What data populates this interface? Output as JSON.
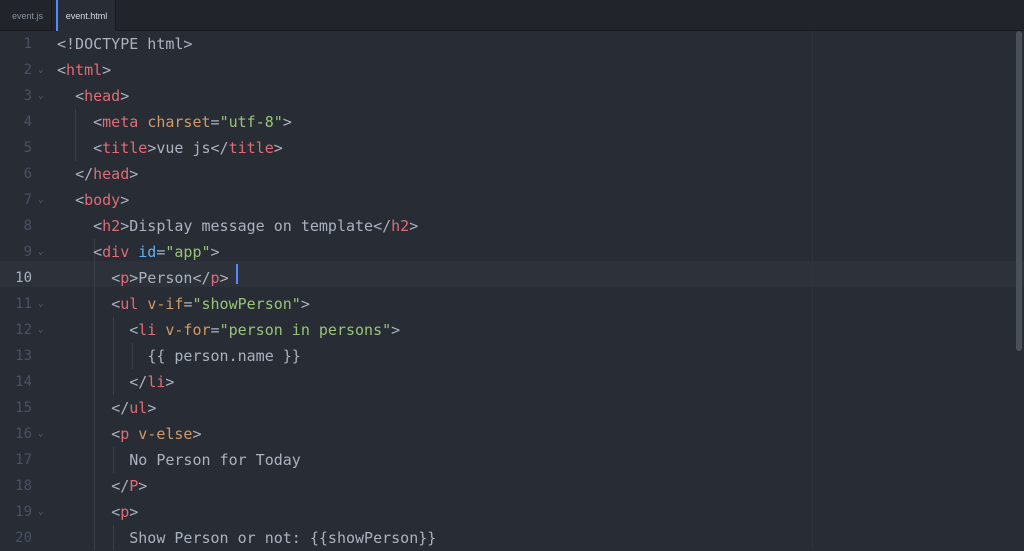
{
  "tabs": [
    {
      "label": "event.js",
      "active": false
    },
    {
      "label": "event.html",
      "active": true
    }
  ],
  "editor": {
    "current_line": 10,
    "lines": [
      {
        "n": "1",
        "fold": "",
        "ind": "",
        "seg": [
          [
            "p",
            "<!DOCTYPE html>"
          ]
        ]
      },
      {
        "n": "2",
        "fold": "⌄",
        "ind": "",
        "seg": [
          [
            "p",
            "<"
          ],
          [
            "t",
            "html"
          ],
          [
            "p",
            ">"
          ]
        ]
      },
      {
        "n": "3",
        "fold": "⌄",
        "ind": "  ",
        "seg": [
          [
            "p",
            "<"
          ],
          [
            "t",
            "head"
          ],
          [
            "p",
            ">"
          ]
        ]
      },
      {
        "n": "4",
        "fold": "",
        "ind": "    ",
        "seg": [
          [
            "p",
            "<"
          ],
          [
            "t",
            "meta"
          ],
          [
            "p",
            " "
          ],
          [
            "a",
            "charset"
          ],
          [
            "p",
            "="
          ],
          [
            "s",
            "\"utf-8\""
          ],
          [
            "p",
            ">"
          ]
        ]
      },
      {
        "n": "5",
        "fold": "",
        "ind": "    ",
        "seg": [
          [
            "p",
            "<"
          ],
          [
            "t",
            "title"
          ],
          [
            "p",
            ">vue js</"
          ],
          [
            "t",
            "title"
          ],
          [
            "p",
            ">"
          ]
        ]
      },
      {
        "n": "6",
        "fold": "",
        "ind": "  ",
        "seg": [
          [
            "p",
            "</"
          ],
          [
            "t",
            "head"
          ],
          [
            "p",
            ">"
          ]
        ]
      },
      {
        "n": "7",
        "fold": "⌄",
        "ind": "  ",
        "seg": [
          [
            "p",
            "<"
          ],
          [
            "t",
            "body"
          ],
          [
            "p",
            ">"
          ]
        ]
      },
      {
        "n": "8",
        "fold": "",
        "ind": "    ",
        "seg": [
          [
            "p",
            "<"
          ],
          [
            "t",
            "h2"
          ],
          [
            "p",
            ">Display message on template</"
          ],
          [
            "t",
            "h2"
          ],
          [
            "p",
            ">"
          ]
        ]
      },
      {
        "n": "9",
        "fold": "⌄",
        "ind": "    ",
        "seg": [
          [
            "p",
            "<"
          ],
          [
            "t",
            "div"
          ],
          [
            "p",
            " "
          ],
          [
            "b",
            "id"
          ],
          [
            "p",
            "="
          ],
          [
            "s",
            "\"app\""
          ],
          [
            "p",
            ">"
          ]
        ]
      },
      {
        "n": "10",
        "fold": "",
        "ind": "      ",
        "seg": [
          [
            "p",
            "<"
          ],
          [
            "t",
            "p"
          ],
          [
            "p",
            ">Person</"
          ],
          [
            "t",
            "p"
          ],
          [
            "p",
            ">"
          ]
        ]
      },
      {
        "n": "11",
        "fold": "⌄",
        "ind": "      ",
        "seg": [
          [
            "p",
            "<"
          ],
          [
            "t",
            "ul"
          ],
          [
            "p",
            " "
          ],
          [
            "a",
            "v-if"
          ],
          [
            "p",
            "="
          ],
          [
            "s",
            "\"showPerson\""
          ],
          [
            "p",
            ">"
          ]
        ]
      },
      {
        "n": "12",
        "fold": "⌄",
        "ind": "        ",
        "seg": [
          [
            "p",
            "<"
          ],
          [
            "t",
            "li"
          ],
          [
            "p",
            " "
          ],
          [
            "a",
            "v-for"
          ],
          [
            "p",
            "="
          ],
          [
            "s",
            "\"person in persons\""
          ],
          [
            "p",
            ">"
          ]
        ]
      },
      {
        "n": "13",
        "fold": "",
        "ind": "          ",
        "seg": [
          [
            "p",
            "{{ person.name }}"
          ]
        ]
      },
      {
        "n": "14",
        "fold": "",
        "ind": "        ",
        "seg": [
          [
            "p",
            "</"
          ],
          [
            "t",
            "li"
          ],
          [
            "p",
            ">"
          ]
        ]
      },
      {
        "n": "15",
        "fold": "",
        "ind": "      ",
        "seg": [
          [
            "p",
            "</"
          ],
          [
            "t",
            "ul"
          ],
          [
            "p",
            ">"
          ]
        ]
      },
      {
        "n": "16",
        "fold": "⌄",
        "ind": "      ",
        "seg": [
          [
            "p",
            "<"
          ],
          [
            "t",
            "p"
          ],
          [
            "p",
            " "
          ],
          [
            "a",
            "v-else"
          ],
          [
            "p",
            ">"
          ]
        ]
      },
      {
        "n": "17",
        "fold": "",
        "ind": "        ",
        "seg": [
          [
            "p",
            "No Person for Today"
          ]
        ]
      },
      {
        "n": "18",
        "fold": "",
        "ind": "      ",
        "seg": [
          [
            "p",
            "</"
          ],
          [
            "t",
            "P"
          ],
          [
            "p",
            ">"
          ]
        ]
      },
      {
        "n": "19",
        "fold": "⌄",
        "ind": "      ",
        "seg": [
          [
            "p",
            "<"
          ],
          [
            "t",
            "p"
          ],
          [
            "p",
            ">"
          ]
        ]
      },
      {
        "n": "20",
        "fold": "",
        "ind": "        ",
        "seg": [
          [
            "p",
            "Show Person or not: {{showPerson}}"
          ]
        ]
      }
    ]
  },
  "colors": {
    "background": "#282c34",
    "tag": "#e06c75",
    "attribute": "#d19a66",
    "string": "#98c379",
    "id_attribute": "#61afef",
    "plain": "#abb2bf",
    "cursor": "#528bff"
  }
}
